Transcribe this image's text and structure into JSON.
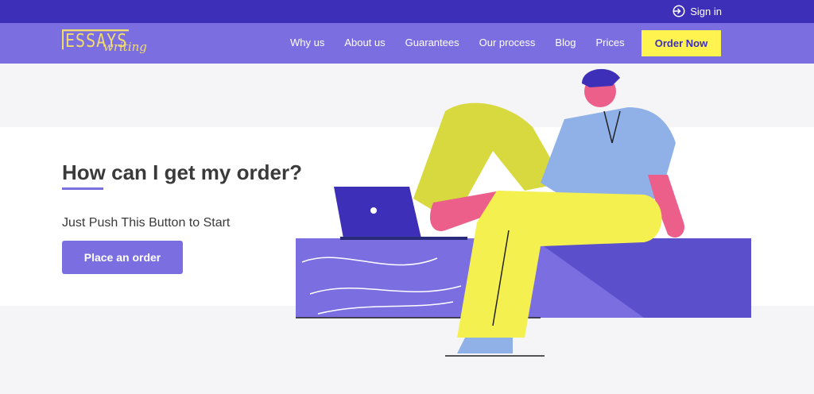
{
  "topbar": {
    "signin_label": "Sign in",
    "signin_icon": "sign-in-icon"
  },
  "logo": {
    "main": "ESSAYS",
    "sub": "writing"
  },
  "nav": {
    "items": [
      "Why us",
      "About us",
      "Guarantees",
      "Our process",
      "Blog",
      "Prices"
    ],
    "order_button": "Order Now"
  },
  "hero": {
    "title": "How can I get my order?",
    "subtitle": "Just Push This Button to Start",
    "cta": "Place an order"
  },
  "colors": {
    "topbar": "#3d2fb8",
    "navbar": "#7b6ee0",
    "accent": "#fff44f",
    "button": "#7b6ee0"
  }
}
